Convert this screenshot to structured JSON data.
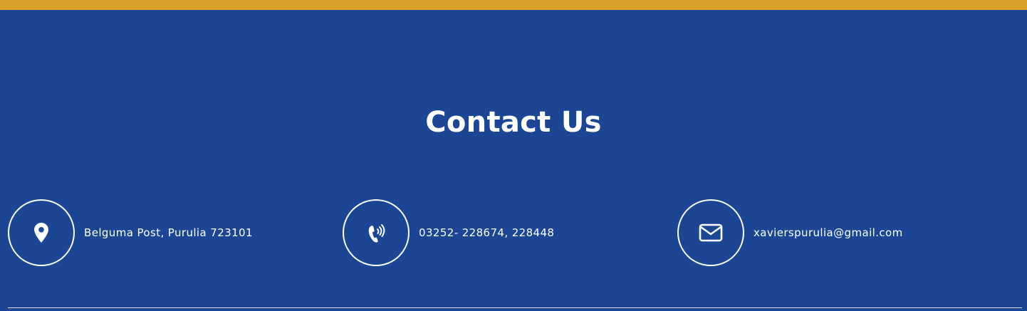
{
  "colors": {
    "background": "#1c4694",
    "top_bar": "#daa02b",
    "text": "#ffffff"
  },
  "section": {
    "title": "Contact Us"
  },
  "contacts": [
    {
      "icon": "map-pin-icon",
      "text": "Belguma Post, Purulia 723101"
    },
    {
      "icon": "phone-icon",
      "text": "03252- 228674, 228448"
    },
    {
      "icon": "envelope-icon",
      "text": "xavierspurulia@gmail.com"
    }
  ]
}
